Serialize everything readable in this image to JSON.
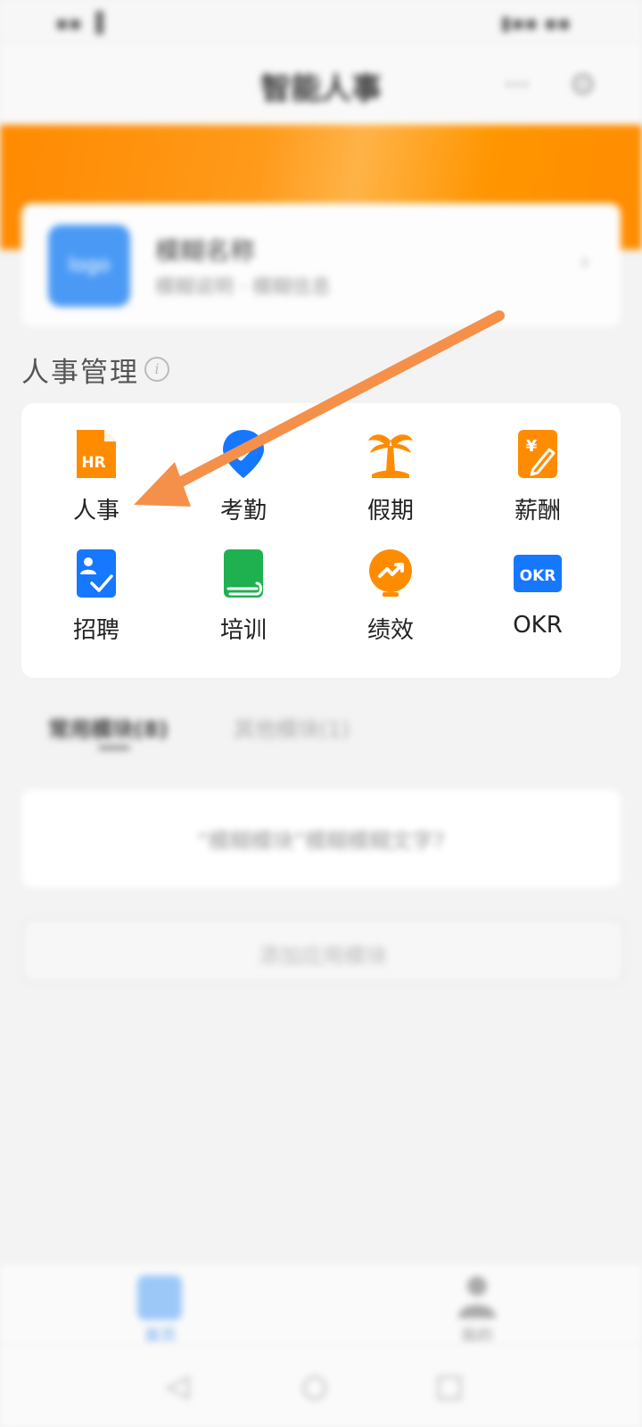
{
  "status_bar": {
    "left_text": "▪▪ ▐",
    "right_text": "▮▪▪ ▪▪"
  },
  "header": {
    "title": "智能人事",
    "more_label": "···",
    "close_label": "⊙"
  },
  "company": {
    "logo_text": "logo",
    "name": "模糊名称",
    "subtitle": "模糊说明 · 模糊信息",
    "chevron": "›"
  },
  "section": {
    "title": "人事管理",
    "info_glyph": "i"
  },
  "apps": [
    {
      "label": "人事",
      "icon": "hr-file-icon",
      "color": "#ff8c00"
    },
    {
      "label": "考勤",
      "icon": "location-check-icon",
      "color": "#1677ff"
    },
    {
      "label": "假期",
      "icon": "palm-tree-icon",
      "color": "#ff8c00"
    },
    {
      "label": "薪酬",
      "icon": "yen-pen-icon",
      "color": "#ff8c00"
    },
    {
      "label": "招聘",
      "icon": "user-check-icon",
      "color": "#1677ff"
    },
    {
      "label": "培训",
      "icon": "book-icon",
      "color": "#1fb14f"
    },
    {
      "label": "绩效",
      "icon": "trend-up-icon",
      "color": "#ff8c00"
    },
    {
      "label": "OKR",
      "icon": "okr-icon",
      "color": "#1677ff",
      "icon_text": "OKR"
    }
  ],
  "tabs": [
    {
      "label": "常用模块(8)"
    },
    {
      "label": "其他模块(1)"
    }
  ],
  "notice": {
    "text": "“模糊模块”模糊模糊文字?"
  },
  "add_button": {
    "label": "添加应用模块"
  },
  "bottom_nav": {
    "home_label": "首页",
    "me_label": "我的"
  },
  "system_nav": {
    "back": "◁",
    "home": "○",
    "recent": "□"
  },
  "colors": {
    "accent_orange": "#ff8c00",
    "accent_blue": "#1677ff",
    "accent_green": "#1fb14f",
    "arrow": "#f5904a"
  }
}
